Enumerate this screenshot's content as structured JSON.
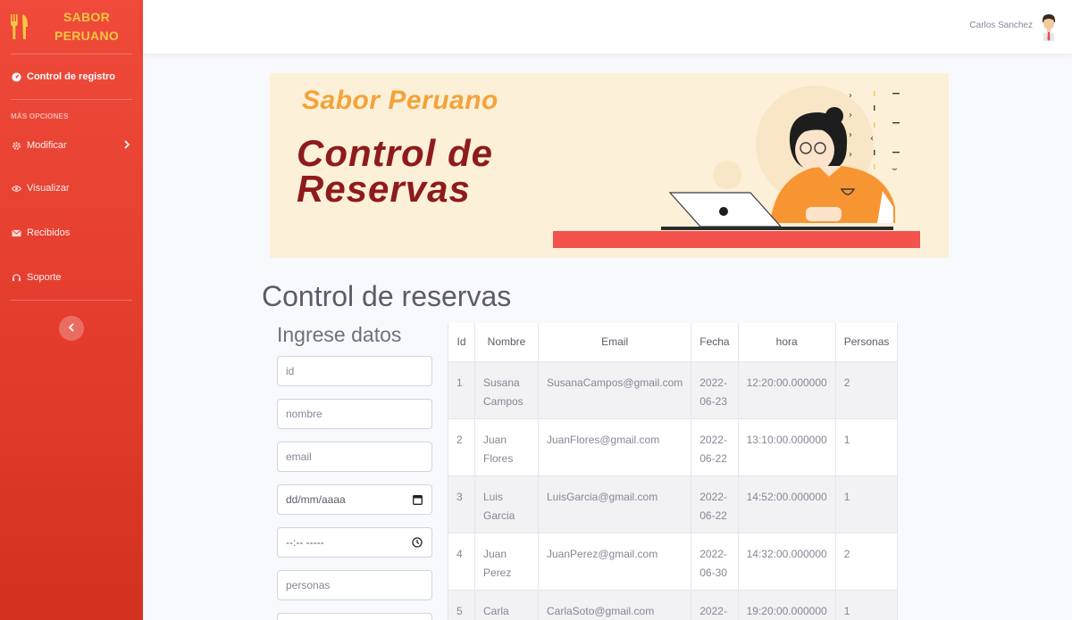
{
  "sidebar": {
    "brand_line1": "SABOR",
    "brand_line2": "PERUANO",
    "active_item": "Control de registro",
    "section_heading": "MÁS OPCIONES",
    "items": [
      {
        "label": "Modificar",
        "icon": "cog-icon"
      },
      {
        "label": "Visualizar",
        "icon": "eye-icon"
      },
      {
        "label": "Recibidos",
        "icon": "envelope-icon"
      },
      {
        "label": "Soporte",
        "icon": "headset-icon"
      }
    ]
  },
  "topbar": {
    "user_name": "Carlos Sanchez"
  },
  "banner": {
    "subtitle": "Sabor Peruano",
    "title": "Control de Reservas"
  },
  "main": {
    "page_title": "Control de reservas",
    "form": {
      "title": "Ingrese datos",
      "fields": {
        "id": "id",
        "nombre": "nombre",
        "email": "email",
        "fecha": "dd/mm/aaaa",
        "hora": "--:-- -----",
        "personas": "personas"
      }
    },
    "table": {
      "headers": [
        "Id",
        "Nombre",
        "Email",
        "Fecha",
        "hora",
        "Personas"
      ],
      "rows": [
        {
          "id": "1",
          "nombre": "Susana Campos",
          "email": "SusanaCampos@gmail.com",
          "fecha": "2022-06-23",
          "hora": "12:20:00.000000",
          "personas": "2"
        },
        {
          "id": "2",
          "nombre": "Juan Flores",
          "email": "JuanFlores@gmail.com",
          "fecha": "2022-06-22",
          "hora": "13:10:00.000000",
          "personas": "1"
        },
        {
          "id": "3",
          "nombre": "Luis Garcia",
          "email": "LuisGarcia@gmail.com",
          "fecha": "2022-06-22",
          "hora": "14:52:00.000000",
          "personas": "1"
        },
        {
          "id": "4",
          "nombre": "Juan Perez",
          "email": "JuanPerez@gmail.com",
          "fecha": "2022-06-30",
          "hora": "14:32:00.000000",
          "personas": "2"
        },
        {
          "id": "5",
          "nombre": "Carla",
          "email": "CarlaSoto@gmail.com",
          "fecha": "2022-",
          "hora": "19:20:00.000000",
          "personas": "1"
        }
      ]
    }
  },
  "colors": {
    "sidebar": "#e23b2c",
    "brand_text": "#f6c744",
    "banner_bg": "#fdf0d8",
    "banner_title": "#8e1b1b",
    "banner_subtitle": "#f2a33a"
  }
}
